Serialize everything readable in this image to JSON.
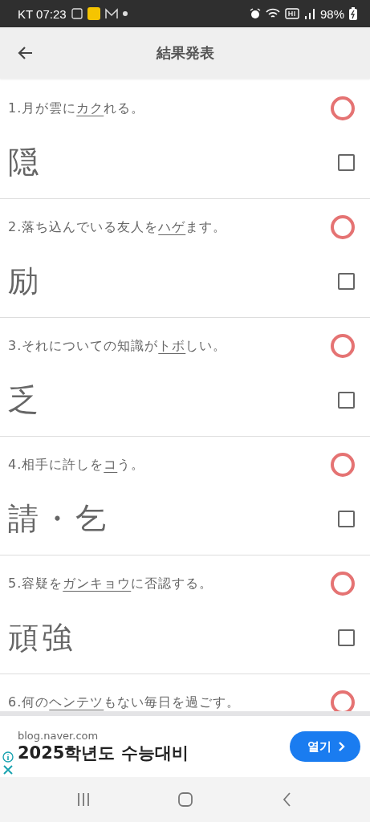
{
  "status_bar": {
    "carrier_time": "KT 07:23",
    "battery": "98%"
  },
  "header": {
    "title": "結果発表"
  },
  "questions": [
    {
      "number": "1.",
      "before": "月が雲に",
      "reading": "カク",
      "after": "れる。",
      "answer": "隠",
      "correct": true,
      "checked": false
    },
    {
      "number": "2.",
      "before": "落ち込んでいる友人を",
      "reading": "ハゲ",
      "after": "ます。",
      "answer": "励",
      "correct": true,
      "checked": false
    },
    {
      "number": "3.",
      "before": "それについての知識が",
      "reading": "トボ",
      "after": "しい。",
      "answer": "乏",
      "correct": true,
      "checked": false
    },
    {
      "number": "4.",
      "before": "相手に許しを",
      "reading": "コ",
      "after": "う。",
      "answer": "請・乞",
      "correct": true,
      "checked": false
    },
    {
      "number": "5.",
      "before": "容疑を",
      "reading": "ガンキョウ",
      "after": "に否認する。",
      "answer": "頑強",
      "correct": true,
      "checked": false
    },
    {
      "number": "6.",
      "before": "何の",
      "reading": "ヘンテツ",
      "after": "もない毎日を過ごす。",
      "correct": true
    }
  ],
  "ad": {
    "domain": "blog.naver.com",
    "headline": "2025학년도 수능대비",
    "button": "열기"
  }
}
